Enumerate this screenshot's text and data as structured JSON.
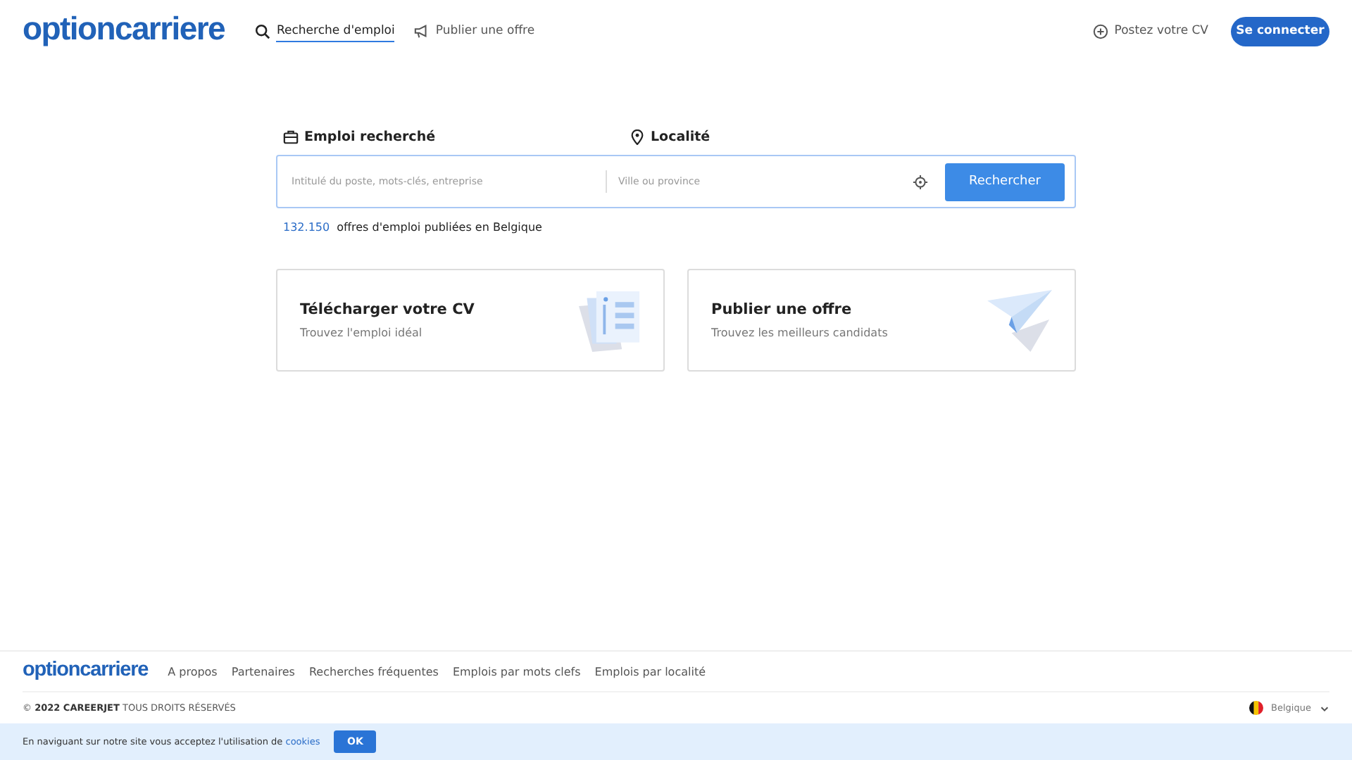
{
  "header": {
    "logo": "optioncarriere",
    "nav": [
      {
        "kind": "search",
        "label": "Recherche d'emploi",
        "selected": true
      },
      {
        "kind": "publish",
        "label": "Publier une offre",
        "selected": false
      }
    ],
    "post_cv": "Postez votre CV",
    "login": "Se connecter"
  },
  "search": {
    "job_label": "Emploi recherché",
    "job_placeholder": "Intitulé du poste, mots-clés, entreprise",
    "location_label": "Localité",
    "location_placeholder": "Ville ou province",
    "button": "Rechercher",
    "count": "132.150",
    "count_text": "offres d'emploi publiées en Belgique"
  },
  "cards": [
    {
      "kind": "cv",
      "title": "Télécharger votre CV",
      "subtitle": "Trouvez l'emploi idéal"
    },
    {
      "kind": "plane",
      "title": "Publier une offre",
      "subtitle": "Trouvez les meilleurs candidats"
    }
  ],
  "footer": {
    "logo": "optioncarriere",
    "links": [
      "A propos",
      "Partenaires",
      "Recherches fréquentes",
      "Emplois par mots clefs",
      "Emplois par localité"
    ],
    "copyright": "©  **2022 CAREERJET** TOUS DROITS RÉSERVÉS",
    "country": "Belgique"
  },
  "cookie_bar": {
    "text": "En naviguant sur notre site vous acceptez l'utilisation de ",
    "link": "cookies",
    "button": "OK"
  }
}
